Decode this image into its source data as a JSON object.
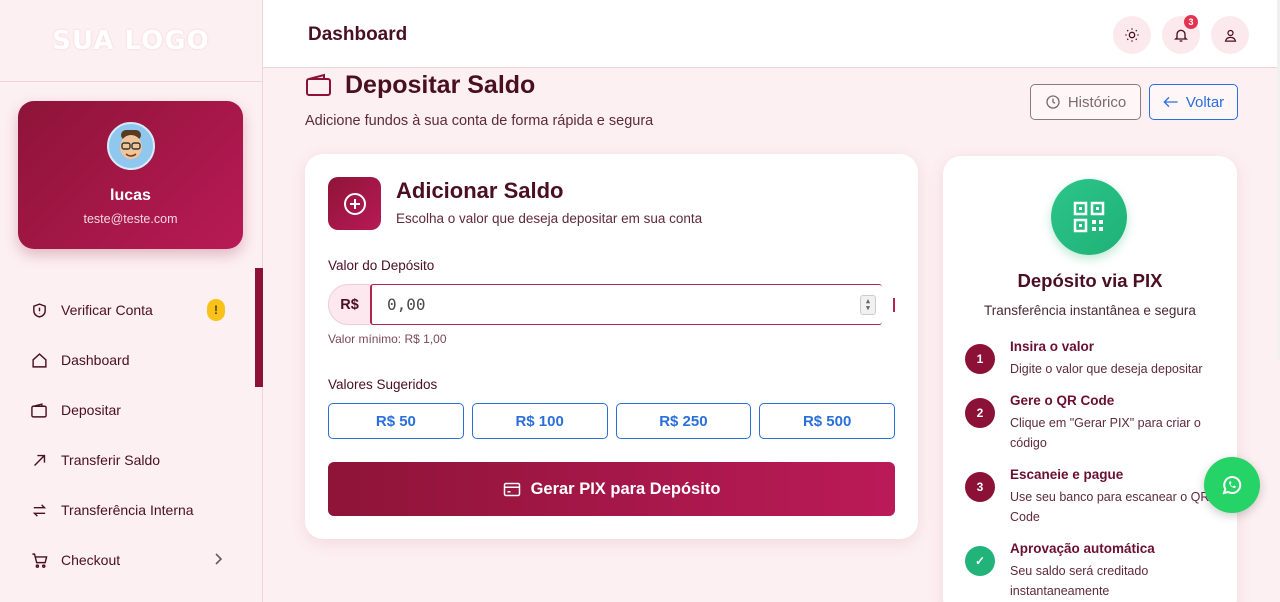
{
  "sidebar": {
    "logo": "SUA LOGO",
    "user": {
      "name": "lucas",
      "email": "teste@teste.com"
    },
    "items": [
      {
        "label": "Verificar Conta",
        "badge": "!"
      },
      {
        "label": "Dashboard"
      },
      {
        "label": "Depositar"
      },
      {
        "label": "Transferir Saldo"
      },
      {
        "label": "Transferência Interna"
      },
      {
        "label": "Checkout"
      }
    ]
  },
  "header": {
    "title": "Dashboard",
    "notification_count": "3"
  },
  "page": {
    "title": "Depositar Saldo",
    "subtitle": "Adicione fundos à sua conta de forma rápida e segura",
    "history_label": "Histórico",
    "back_label": "Voltar"
  },
  "deposit": {
    "title": "Adicionar Saldo",
    "subtitle": "Escolha o valor que deseja depositar em sua conta",
    "field_label": "Valor do Depósito",
    "currency_prefix": "R$",
    "amount_value": "0,00",
    "min_hint": "Valor mínimo: R$ 1,00",
    "suggested_label": "Valores Sugeridos",
    "suggested": [
      "R$ 50",
      "R$ 100",
      "R$ 250",
      "R$ 500"
    ],
    "generate_label": "Gerar PIX para Depósito"
  },
  "pix": {
    "title": "Depósito via PIX",
    "subtitle": "Transferência instantânea e segura",
    "steps": [
      {
        "num": "1",
        "title": "Insira o valor",
        "desc": "Digite o valor que deseja depositar"
      },
      {
        "num": "2",
        "title": "Gere o QR Code",
        "desc": "Clique em \"Gerar PIX\" para criar o código"
      },
      {
        "num": "3",
        "title": "Escaneie e pague",
        "desc": "Use seu banco para escanear o QR Code"
      },
      {
        "num": "✓",
        "title": "Aprovação automática",
        "desc": "Seu saldo será creditado instantaneamente"
      }
    ]
  },
  "colors": {
    "brand": "#8e1438",
    "brand_light": "#b81a55",
    "link_blue": "#2a6fdb",
    "success": "#22b37a",
    "whatsapp": "#25d366"
  }
}
